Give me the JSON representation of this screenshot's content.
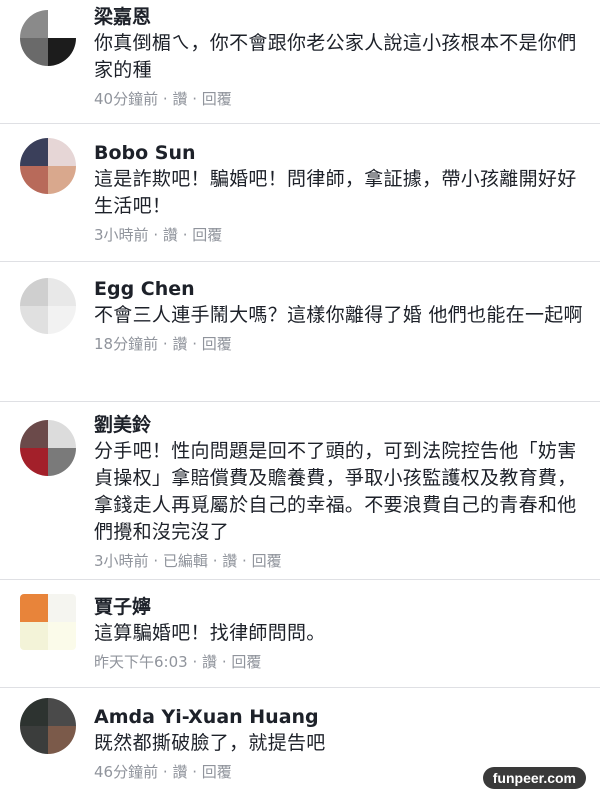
{
  "comments": [
    {
      "name": "梁嘉恩",
      "text": "你真倒楣ㄟ，你不會跟你老公家人說這小孩根本不是你們家的種",
      "time": "40分鐘前",
      "extra": "",
      "read": "讚",
      "reply": "回覆",
      "avatar_colors": [
        "#8a8a8a",
        "#ffffff",
        "#6a6a6a",
        "#1c1c1c"
      ]
    },
    {
      "name": "Bobo Sun",
      "text": "這是詐欺吧！騙婚吧！問律師，拿証據，帶小孩離開好好生活吧！",
      "time": "3小時前",
      "extra": "",
      "read": "讚",
      "reply": "回覆",
      "avatar_colors": [
        "#3a3f5a",
        "#e6d6d6",
        "#b86a5a",
        "#d9a88d"
      ]
    },
    {
      "name": "Egg Chen",
      "text": "不會三人連手鬧大嗎？這樣你離得了婚 他們也能在一起啊",
      "time": "18分鐘前",
      "extra": "",
      "read": "讚",
      "reply": "回覆",
      "avatar_colors": [
        "#cfcfcf",
        "#e8e8e8",
        "#e0e0e0",
        "#f2f2f2"
      ]
    },
    {
      "name": "劉美鈴",
      "text": "分手吧！性向問題是回不了頭的，可到法院控告他「妨害貞操权」拿賠償費及贍養費，爭取小孩監護权及教育費，拿錢走人再覓屬於自己的幸福。不要浪費自己的青春和他們攪和沒完沒了",
      "time": "3小時前",
      "extra": "已編輯",
      "read": "讚",
      "reply": "回覆",
      "avatar_colors": [
        "#6b4a4a",
        "#dcdcdc",
        "#a3202a",
        "#7a7a7a"
      ]
    },
    {
      "name": "賈子嬣",
      "text": "這算騙婚吧！找律師問問。",
      "time": "昨天下午6:03",
      "extra": "",
      "read": "讚",
      "reply": "回覆",
      "avatar_colors": [
        "#e8843a",
        "#f5f5f0",
        "#f3f3d8",
        "#fbfbea"
      ]
    },
    {
      "name": "Amda Yi-Xuan Huang",
      "text": "既然都撕破臉了，就提告吧",
      "time": "46分鐘前",
      "extra": "",
      "read": "讚",
      "reply": "回覆",
      "avatar_colors": [
        "#2d3330",
        "#4a4a4a",
        "#3b3d3c",
        "#7b5a4a"
      ]
    }
  ],
  "separator": "·",
  "watermark": "funpeer.com"
}
